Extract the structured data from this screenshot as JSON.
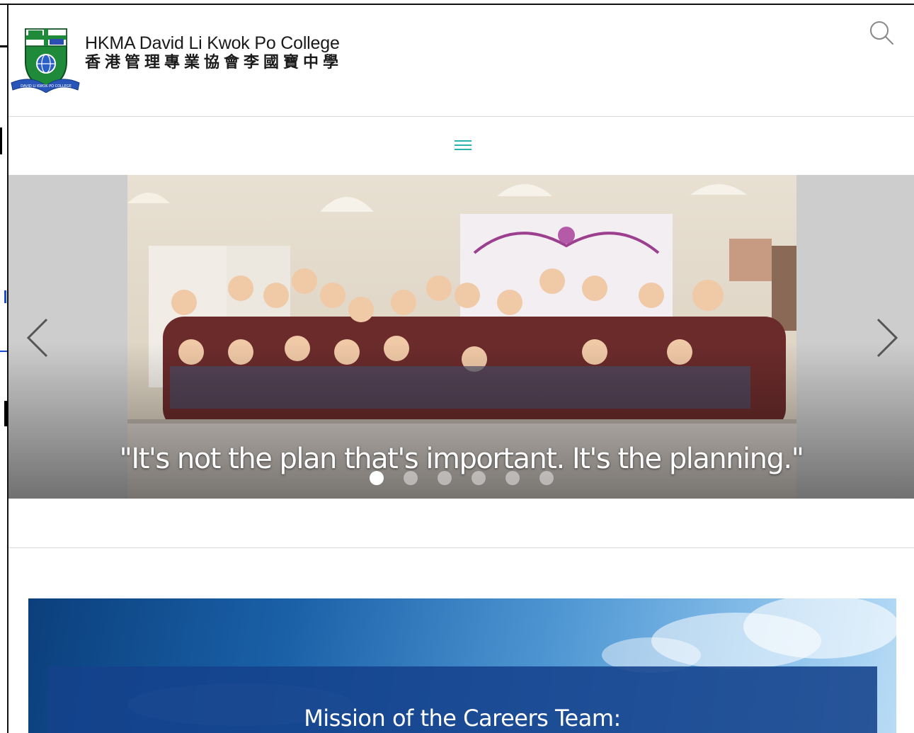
{
  "header": {
    "school_name_en": "HKMA David Li Kwok Po College",
    "school_name_zh": "香港管理專業協會李國寶中學",
    "logo_ribbon_text": "DAVID LI KWOK PO COLLEGE",
    "search_icon": "search-icon"
  },
  "nav": {
    "menu_icon": "hamburger-menu-icon",
    "menu_color": "#2bb3b0"
  },
  "slider": {
    "caption": "\"It's not the plan that's important. It's the planning.\"",
    "prev_icon": "chevron-left-icon",
    "next_icon": "chevron-right-icon",
    "slide_count": 6,
    "active_slide": 1
  },
  "mission": {
    "title": "Mission of the Careers Team:"
  }
}
